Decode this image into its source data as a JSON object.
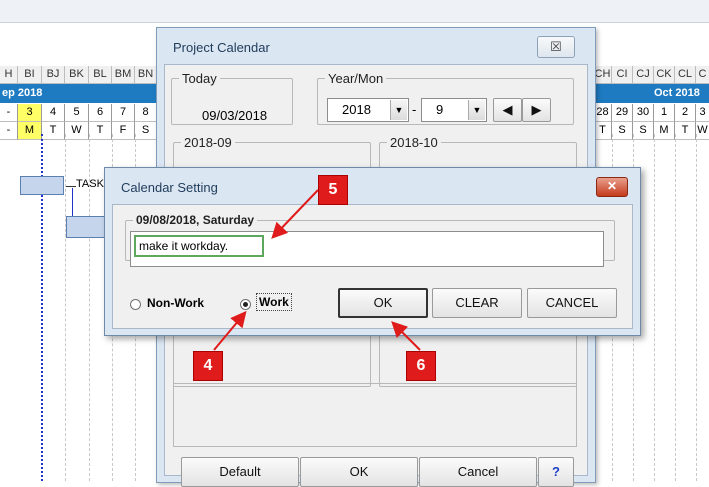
{
  "sheet": {
    "columns_left": [
      "H",
      "BI",
      "BJ",
      "BK",
      "BL",
      "BM",
      "BN"
    ],
    "columns_right": [
      "CH",
      "CI",
      "CJ",
      "CK",
      "CL",
      "C"
    ],
    "month_left": "ep 2018",
    "month_right": "Oct 2018",
    "dates_left": [
      "3",
      "4",
      "5",
      "6",
      "7",
      "8"
    ],
    "days_left": [
      "M",
      "T",
      "W",
      "T",
      "F",
      "S"
    ],
    "dates_right": [
      "28",
      "29",
      "30",
      "1",
      "2",
      "3"
    ],
    "days_right": [
      "T",
      "S",
      "S",
      "M",
      "T",
      "W"
    ],
    "row_prefix": "-",
    "task_label": "TASK",
    "highlight_color": "#ffff66",
    "month_color": "#1f7bc1"
  },
  "project_calendar": {
    "title": "Project Calendar",
    "close_glyph": "☒",
    "today_legend": "Today",
    "today_value": "09/03/2018",
    "yearmon_legend": "Year/Mon",
    "year_value": "2018",
    "month_value": "9",
    "separator": "-",
    "prev_glyph": "◀",
    "next_glyph": "▶",
    "cal_left_legend": "2018-09",
    "cal_right_legend": "2018-10",
    "default_label": "Default",
    "ok_label": "OK",
    "cancel_label": "Cancel",
    "help_label": "?"
  },
  "calendar_setting": {
    "title": "Calendar Setting",
    "close_glyph": "✕",
    "date_legend": "09/08/2018, Saturday",
    "memo_value": "make it workday.",
    "nonwork_label": "Non-Work",
    "work_label": "Work",
    "selected": "Work",
    "ok_label": "OK",
    "clear_label": "CLEAR",
    "cancel_label": "CANCEL"
  },
  "callouts": {
    "c5": "5",
    "c4": "4",
    "c6": "6",
    "color": "#e01b1b"
  }
}
